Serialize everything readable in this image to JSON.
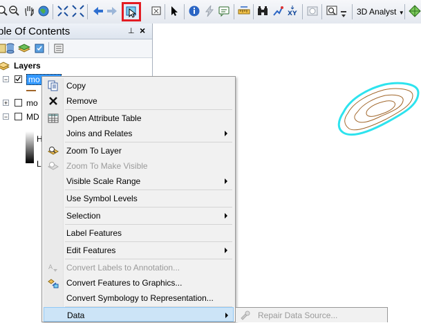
{
  "toolbar": {
    "dropdown_label": "3D Analyst",
    "icons": [
      "zoom-in-icon",
      "zoom-out-icon",
      "pan-icon",
      "full-extent-icon",
      "fixed-zoom-in-icon",
      "fixed-zoom-out-icon",
      "back-icon",
      "forward-icon",
      "select-features-icon",
      "clear-selection-icon",
      "select-elements-icon",
      "identify-icon",
      "hyperlink-icon",
      "html-popup-icon",
      "measure-icon",
      "find-icon",
      "go-to-xy-icon",
      "time-slider-icon",
      "magnifier-icon",
      "3d-analyst-dropdown",
      "create-tin-icon"
    ],
    "highlight_color": "#e31c23"
  },
  "toc": {
    "title": "ble Of Contents",
    "pin_glyph": "⊥",
    "close_glyph": "×",
    "root_label": "Layers",
    "layers": [
      {
        "label": "mo",
        "checked": true,
        "selected": true
      },
      {
        "label": "mo",
        "checked": false,
        "selected": false
      },
      {
        "label": "MD",
        "checked": false,
        "selected": false
      }
    ],
    "legend_high": "H",
    "legend_low": "L"
  },
  "context_menu": {
    "items": [
      {
        "label": "Copy",
        "icon": "copy-icon",
        "enabled": true,
        "submenu": false
      },
      {
        "label": "Remove",
        "icon": "remove-icon",
        "enabled": true,
        "submenu": false
      },
      {
        "label": "Open Attribute Table",
        "icon": "table-icon",
        "enabled": true,
        "submenu": false
      },
      {
        "label": "Joins and Relates",
        "icon": "",
        "enabled": true,
        "submenu": true
      },
      {
        "label": "Zoom To Layer",
        "icon": "zoom-to-layer-icon",
        "enabled": true,
        "submenu": false
      },
      {
        "label": "Zoom To Make Visible",
        "icon": "zoom-visible-icon",
        "enabled": false,
        "submenu": false
      },
      {
        "label": "Visible Scale Range",
        "icon": "",
        "enabled": true,
        "submenu": true
      },
      {
        "label": "Use Symbol Levels",
        "icon": "",
        "enabled": true,
        "submenu": false
      },
      {
        "label": "Selection",
        "icon": "",
        "enabled": true,
        "submenu": true
      },
      {
        "label": "Label Features",
        "icon": "",
        "enabled": true,
        "submenu": false
      },
      {
        "label": "Edit Features",
        "icon": "",
        "enabled": true,
        "submenu": true
      },
      {
        "label": "Convert Labels to Annotation...",
        "icon": "convert-labels-icon",
        "enabled": false,
        "submenu": false
      },
      {
        "label": "Convert Features to Graphics...",
        "icon": "convert-features-icon",
        "enabled": true,
        "submenu": false
      },
      {
        "label": "Convert Symbology to Representation...",
        "icon": "",
        "enabled": true,
        "submenu": false
      },
      {
        "label": "Data",
        "icon": "",
        "enabled": true,
        "submenu": true,
        "highlighted": true
      }
    ]
  },
  "submenu": {
    "label": "Repair Data Source...",
    "enabled": false
  },
  "map": {
    "outline_color": "#2de3ee",
    "contour_color": "#a0662a"
  }
}
